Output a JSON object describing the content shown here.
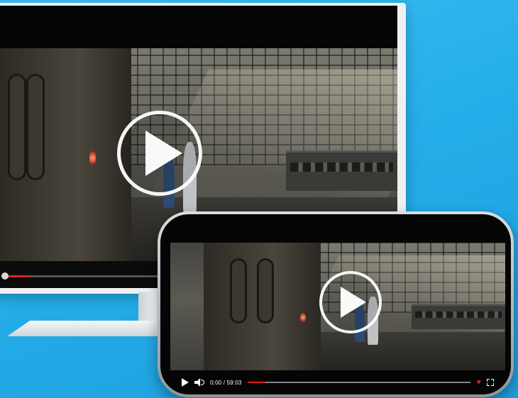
{
  "monitor_player": {
    "progress_fraction": 0.14,
    "accent_color": "#e02020",
    "overlay_icon": "play-icon"
  },
  "phone_player": {
    "time_display": "0:00 / 59:03",
    "progress_fraction": 0.08,
    "accent_color": "#e02020",
    "overlay_icon": "play-icon",
    "controls_icons": [
      "play-icon",
      "volume-icon",
      "heart-icon",
      "fullscreen-icon"
    ]
  },
  "colors": {
    "background": "#29b0ea",
    "progress_fill": "#e02020"
  }
}
